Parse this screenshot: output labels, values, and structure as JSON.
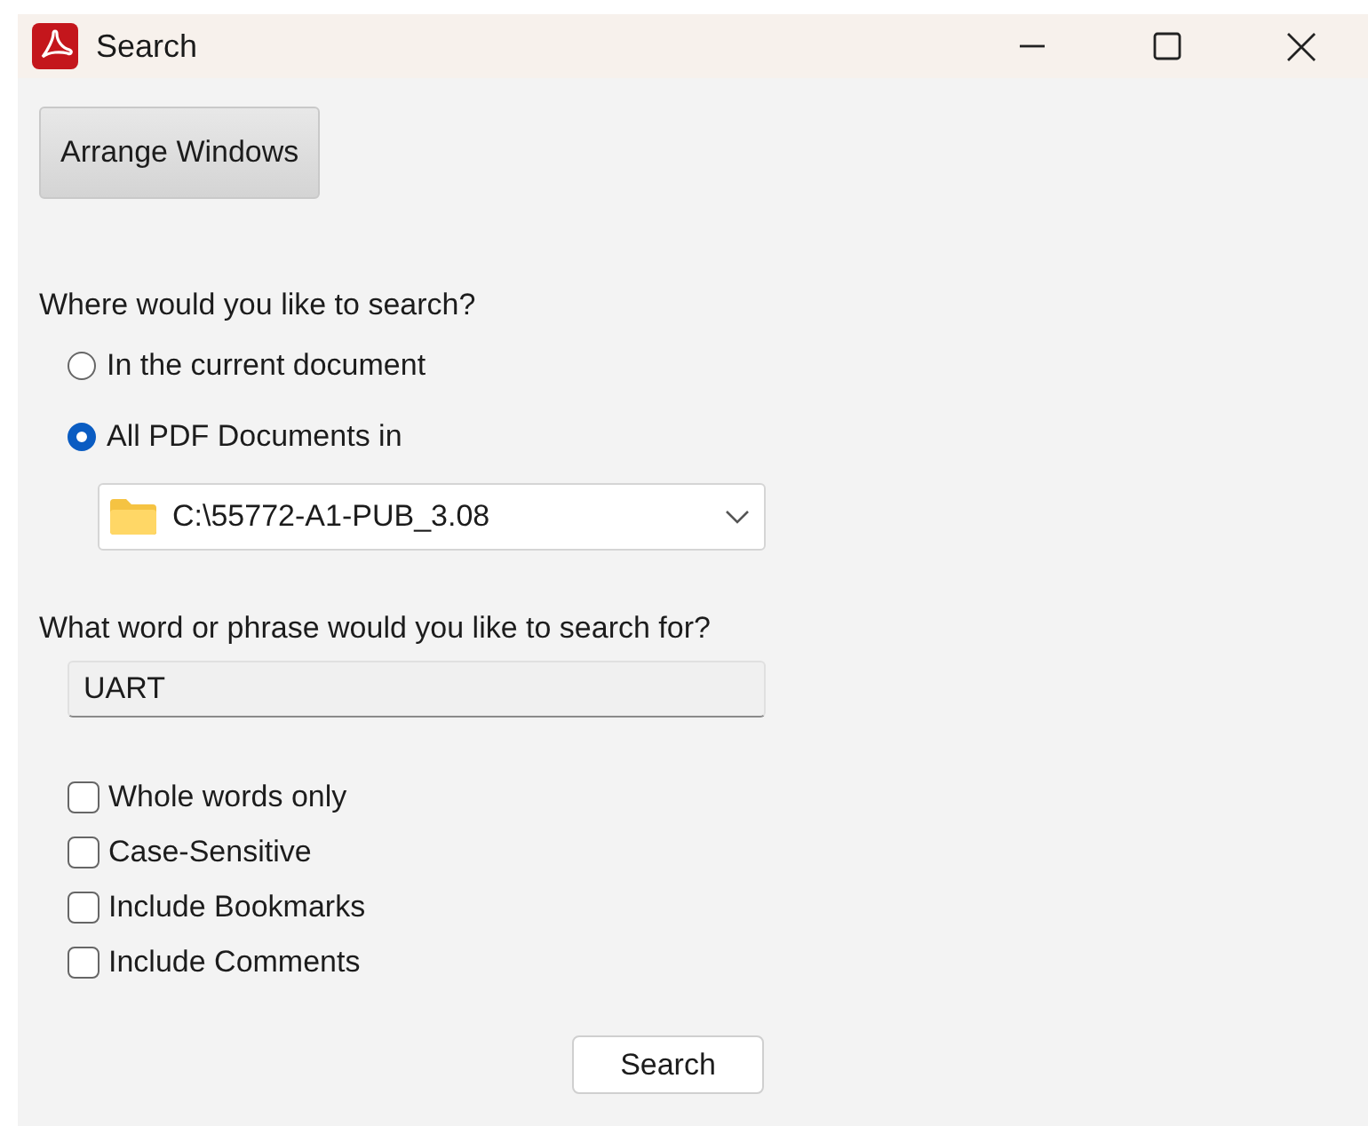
{
  "window": {
    "title": "Search"
  },
  "arrange_button": "Arrange Windows",
  "location": {
    "label": "Where would you like to search?",
    "options": [
      {
        "label": "In the current document",
        "selected": false
      },
      {
        "label": "All PDF Documents in",
        "selected": true
      }
    ],
    "folder": "C:\\55772-A1-PUB_3.08"
  },
  "query": {
    "label": "What word or phrase would you like to search for?",
    "value": "UART"
  },
  "options": [
    {
      "label": "Whole words only",
      "checked": false
    },
    {
      "label": "Case-Sensitive",
      "checked": false
    },
    {
      "label": "Include Bookmarks",
      "checked": false
    },
    {
      "label": "Include Comments",
      "checked": false
    }
  ],
  "search_button": "Search"
}
